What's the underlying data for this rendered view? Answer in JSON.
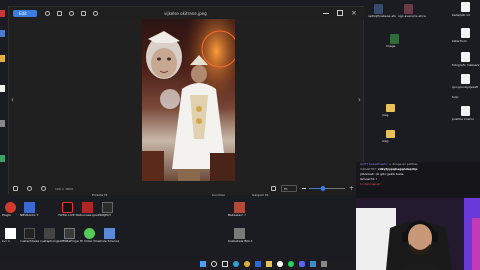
{
  "viewer": {
    "title": "vijkelse okitrane.jpeg",
    "edit_label": "Edit",
    "info_text": "100 × 1824",
    "zoom": "Fit",
    "zoom_level": 0.4
  },
  "desktop_right": [
    {
      "label": "kedel/Ati 14",
      "kind": "file"
    },
    {
      "label": "kateritum",
      "kind": "file"
    },
    {
      "label": "fotografo maksanrmi",
      "kind": "file"
    },
    {
      "label": "qoi qouvbyqveafi",
      "kind": "file"
    },
    {
      "label": "toljo",
      "kind": "file"
    },
    {
      "label": "pushhe knsmo",
      "kind": "file"
    }
  ],
  "desktop_mid": [
    {
      "label": "netlcqfinabeoe ahonrn",
      "kind": "img"
    },
    {
      "label": "ogo avarums ahcehiam",
      "kind": "img"
    },
    {
      "label": "Image",
      "kind": "img"
    },
    {
      "label": "Image",
      "kind": "img"
    },
    {
      "label": "msg",
      "kind": "folder"
    },
    {
      "label": "msg",
      "kind": "folder"
    }
  ],
  "desktop_bottom_row1": [
    {
      "label": "Plugin",
      "color": "#d23a2e"
    },
    {
      "label": "NBVRACIG T",
      "color": "#3a6ad0"
    },
    {
      "label": "TikTok LIVE Studio",
      "color": "#111111"
    },
    {
      "label": "Abonnee Ipad",
      "color": "#b02525"
    },
    {
      "label": "PROJECT",
      "color": "#2a2a2a"
    },
    {
      "label": "Babbelen! ?",
      "color": "#b24a3a"
    }
  ],
  "desktop_bottom_row2": [
    {
      "label": "Lvc 1",
      "color": "#ffffff"
    },
    {
      "label": "cuatachbeke",
      "color": "#222222"
    },
    {
      "label": "cuataphonge",
      "color": "#444444"
    },
    {
      "label": "OBSBaProge",
      "color": "#3a3a3a"
    },
    {
      "label": "HI Video Downloader",
      "color": "#56c956"
    },
    {
      "label": "Cole Science",
      "color": "#5a8ad8"
    },
    {
      "label": "Koekebele Bilk Koenig",
      "color": "#7a7a7a"
    }
  ],
  "section_headers": [
    "Prokote HI",
    "Conrmar",
    "Gargum 01"
  ],
  "chat": [
    {
      "user": "GOTT twbaltmeitx:",
      "text": "u dooge ao patmai",
      "color": "#8e7cff"
    },
    {
      "user": "rokoq0767:",
      "text": "rdkyfyypqhagqndsprkp",
      "color": "#ffffff"
    },
    {
      "user": "jobonkeb:",
      "text": "ok gibr gekik bana",
      "color": "#ffffff"
    },
    {
      "user": "lamoel74:",
      "text": "!",
      "color": "#ffffff"
    },
    {
      "user": "tordaninepak:",
      "text": "",
      "color": "#e84f4f"
    }
  ],
  "taskbar_icons": [
    "windows-icon",
    "search-icon",
    "task-view-icon",
    "edge-icon",
    "chrome-icon",
    "store-icon",
    "explorer-icon",
    "obs-icon",
    "spotify-icon",
    "discord-icon",
    "photos-icon",
    "camera-icon"
  ]
}
